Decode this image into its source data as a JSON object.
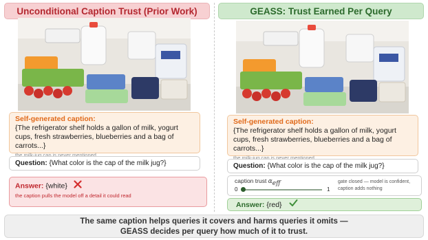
{
  "left_panel": {
    "title": "Unconditional Caption Trust (Prior Work)",
    "caption_label": "Self-generated caption:",
    "caption_text": "{The refrigerator shelf holds a gallon of milk, yogurt cups, fresh strawberries, blueberries and a bag of carrots...}",
    "caption_note": "the milk-jug cap is never mentioned",
    "question_label": "Question:",
    "question_text": "{What color is the cap of the milk jug?}",
    "answer_label": "Answer:",
    "answer_value": "{white}",
    "answer_note": "the caption pulls the model off a detail it could read",
    "answer_status_icon": "cross-icon",
    "accent_color": "#c0282f"
  },
  "right_panel": {
    "title": "GEASS: Trust Earned Per Query",
    "caption_label": "Self-generated caption:",
    "caption_text": "{The refrigerator shelf holds a gallon of milk, yogurt cups, fresh strawberries, blueberries and a bag of carrots...}",
    "caption_note": "the milk-jug cap is never mentioned",
    "question_label": "Question:",
    "question_text": "{What color is the cap of the milk jug?}",
    "gate": {
      "label": "caption trust",
      "symbol": "α",
      "symbol_sub": "eff",
      "min_label": "0",
      "max_label": "1",
      "value": 0,
      "note": "gate closed — model is confident, caption adds nothing"
    },
    "answer_label": "Answer:",
    "answer_value": "{red}",
    "answer_status_icon": "check-icon",
    "accent_color": "#2c6a2c"
  },
  "footer": {
    "line1": "The same caption helps queries it covers and harms queries it omits —",
    "line2": "GEASS decides per query how much of it to trust."
  }
}
